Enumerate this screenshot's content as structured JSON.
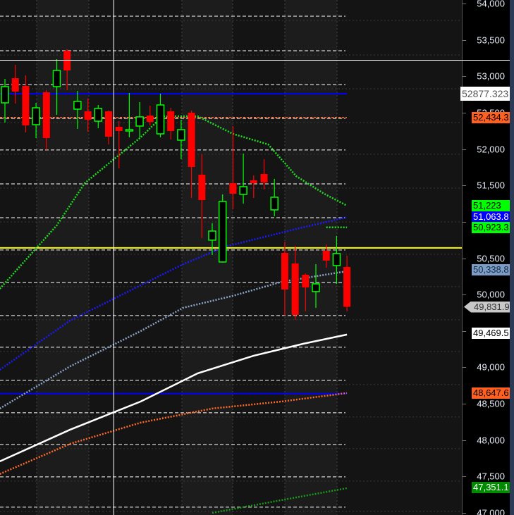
{
  "chart_data": {
    "type": "candlestick",
    "title": "",
    "ylim": [
      47000,
      54000
    ],
    "y_ticks": [
      54000,
      53500,
      53000,
      52500,
      52000,
      51500,
      51000,
      50500,
      50000,
      49500,
      49000,
      48500,
      48000,
      47500,
      47000
    ],
    "y_tick_labels": [
      "54,000",
      "53,500",
      "53,000",
      "52,500",
      "52,000",
      "51,500",
      "51,000",
      "50,500",
      "50,000",
      "49,500",
      "49,000",
      "48,500",
      "48,000",
      "47,500",
      "47,000"
    ],
    "candles": [
      {
        "o": 52635,
        "h": 52964,
        "l": 52364,
        "c": 52858
      },
      {
        "o": 52974,
        "h": 53158,
        "l": 52625,
        "c": 52790
      },
      {
        "o": 52867,
        "h": 53013,
        "l": 52229,
        "c": 52325
      },
      {
        "o": 52335,
        "h": 52635,
        "l": 52151,
        "c": 52567
      },
      {
        "o": 52780,
        "h": 52809,
        "l": 51987,
        "c": 52151
      },
      {
        "o": 52858,
        "h": 53235,
        "l": 52471,
        "c": 53080
      },
      {
        "o": 53351,
        "h": 53371,
        "l": 52809,
        "c": 53080
      },
      {
        "o": 52548,
        "h": 52800,
        "l": 52277,
        "c": 52655
      },
      {
        "o": 52519,
        "h": 52693,
        "l": 52238,
        "c": 52403
      },
      {
        "o": 52383,
        "h": 52606,
        "l": 52287,
        "c": 52558
      },
      {
        "o": 52519,
        "h": 52530,
        "l": 52064,
        "c": 52170
      },
      {
        "o": 52306,
        "h": 52383,
        "l": 51735,
        "c": 52248
      },
      {
        "o": 52248,
        "h": 52771,
        "l": 52161,
        "c": 52267
      },
      {
        "o": 52316,
        "h": 52645,
        "l": 52161,
        "c": 52442
      },
      {
        "o": 52461,
        "h": 52596,
        "l": 52325,
        "c": 52374
      },
      {
        "o": 52209,
        "h": 52761,
        "l": 52161,
        "c": 52606
      },
      {
        "o": 52519,
        "h": 52567,
        "l": 52132,
        "c": 52248
      },
      {
        "o": 52122,
        "h": 52403,
        "l": 51861,
        "c": 52267
      },
      {
        "o": 52500,
        "h": 52529,
        "l": 51328,
        "c": 51754
      },
      {
        "o": 51648,
        "h": 51928,
        "l": 50777,
        "c": 51299
      },
      {
        "o": 50748,
        "h": 50980,
        "l": 50544,
        "c": 50873
      },
      {
        "o": 50448,
        "h": 51377,
        "l": 50438,
        "c": 51280
      },
      {
        "o": 51532,
        "h": 52316,
        "l": 51173,
        "c": 51386
      },
      {
        "o": 51377,
        "h": 51938,
        "l": 51251,
        "c": 51483
      },
      {
        "o": 51571,
        "h": 51638,
        "l": 51328,
        "c": 51532
      },
      {
        "o": 51657,
        "h": 51861,
        "l": 51444,
        "c": 51541
      },
      {
        "o": 51164,
        "h": 51590,
        "l": 51077,
        "c": 51338
      },
      {
        "o": 50573,
        "h": 50728,
        "l": 49712,
        "c": 50070
      },
      {
        "o": 50428,
        "h": 50670,
        "l": 49654,
        "c": 49721
      },
      {
        "o": 50273,
        "h": 50290,
        "l": 49770,
        "c": 50099
      },
      {
        "o": 50041,
        "h": 50418,
        "l": 49818,
        "c": 50147
      },
      {
        "o": 50602,
        "h": 50689,
        "l": 50370,
        "c": 50467
      },
      {
        "o": 50399,
        "h": 50806,
        "l": 50147,
        "c": 50564
      },
      {
        "o": 50380,
        "h": 50535,
        "l": 49770,
        "c": 49832
      }
    ],
    "moving_averages": [
      {
        "name": "ma-green",
        "color": "#22dd22",
        "style": "dotted",
        "points": [
          [
            -0.5,
            50080
          ],
          [
            5,
            50951
          ],
          [
            7.7,
            51532
          ],
          [
            13.1,
            52161
          ],
          [
            15.2,
            52451
          ],
          [
            18.6,
            52451
          ],
          [
            22,
            52209
          ],
          [
            25.4,
            52064
          ],
          [
            28.1,
            51628
          ],
          [
            30.8,
            51386
          ],
          [
            33,
            51222
          ]
        ]
      },
      {
        "name": "ma-blue",
        "color": "#1a1aff",
        "style": "dotted",
        "points": [
          [
            -0.5,
            48966
          ],
          [
            6.3,
            49644
          ],
          [
            13.1,
            50128
          ],
          [
            17.2,
            50418
          ],
          [
            21.3,
            50660
          ],
          [
            25.4,
            50806
          ],
          [
            28.1,
            50902
          ],
          [
            33,
            51064
          ]
        ]
      },
      {
        "name": "ma-steel",
        "color": "#8aa4c8",
        "style": "dotted",
        "points": [
          [
            -0.5,
            48434
          ],
          [
            6.3,
            49015
          ],
          [
            13.1,
            49499
          ],
          [
            17.2,
            49818
          ],
          [
            22,
            49983
          ],
          [
            26.7,
            50176
          ],
          [
            33,
            50322
          ]
        ]
      },
      {
        "name": "ma-white",
        "color": "#ffffff",
        "style": "solid",
        "points": [
          [
            -0.5,
            47708
          ],
          [
            6.3,
            48144
          ],
          [
            13.1,
            48531
          ],
          [
            18.6,
            48918
          ],
          [
            24,
            49160
          ],
          [
            28.8,
            49325
          ],
          [
            33,
            49450
          ]
        ]
      },
      {
        "name": "ma-orange",
        "color": "#ff6a2a",
        "style": "dotted",
        "points": [
          [
            -0.5,
            47534
          ],
          [
            6.3,
            47950
          ],
          [
            13.1,
            48240
          ],
          [
            20,
            48434
          ],
          [
            26.7,
            48531
          ],
          [
            33,
            48647
          ]
        ]
      },
      {
        "name": "ma-darkgreen",
        "color": "#1a9a1a",
        "style": "dotted",
        "points": [
          [
            20,
            47000
          ],
          [
            26.7,
            47176
          ],
          [
            33,
            47340
          ]
        ]
      },
      {
        "name": "ma-green-short",
        "color": "#22dd22",
        "style": "dotted",
        "points": [
          [
            31,
            50923
          ],
          [
            33,
            50923
          ]
        ]
      }
    ],
    "horizontal_lines": [
      {
        "name": "blue-line-upper",
        "price": 52760,
        "color": "#0000ff"
      },
      {
        "name": "blue-line-lower",
        "price": 48640,
        "color": "#0000ff"
      },
      {
        "name": "yellow-line",
        "price": 50641,
        "color": "#ffff00"
      },
      {
        "name": "orange-line",
        "price": 52434,
        "color": "#ff6020",
        "dashed": true
      }
    ],
    "dashed_levels": [
      53826,
      53351,
      52887,
      52422,
      51987,
      51522,
      51057,
      50612,
      50167,
      49712,
      49277,
      48821,
      48376,
      47940,
      47495,
      47079
    ],
    "crosshair": {
      "price": 53226,
      "bar": 10.5
    },
    "price_labels": [
      {
        "text": "52877.323",
        "price": 52760,
        "bg": "#ffffff",
        "fg": "#555555"
      },
      {
        "text": "52,434.3",
        "price": 52434.3,
        "bg": "#ff6020",
        "fg": "#000000"
      },
      {
        "text": "51,223",
        "price": 51223,
        "bg": "#00ff00",
        "fg": "#000000"
      },
      {
        "text": "51,063.8",
        "price": 51063.8,
        "bg": "#0000ff",
        "fg": "#ffffff"
      },
      {
        "text": "50,923.3",
        "price": 50923.3,
        "bg": "#00ff00",
        "fg": "#000000"
      },
      {
        "text": "50,338.8",
        "price": 50338.8,
        "bg": "#7a9cc6",
        "fg": "#1a2a40"
      },
      {
        "text": "49,831.9",
        "price": 49831.9,
        "bg": "#c8c8c8",
        "fg": "#333333"
      },
      {
        "text": "49,469.5",
        "price": 49469.5,
        "bg": "#ffffff",
        "fg": "#000000"
      },
      {
        "text": "48,647.6",
        "price": 48647.6,
        "bg": "#ff6020",
        "fg": "#000000"
      },
      {
        "text": "47,351.1",
        "price": 47351.1,
        "bg": "#008a00",
        "fg": "#ffffff"
      }
    ],
    "colors": {
      "up": "#00ff00",
      "down": "#ff0000"
    }
  }
}
